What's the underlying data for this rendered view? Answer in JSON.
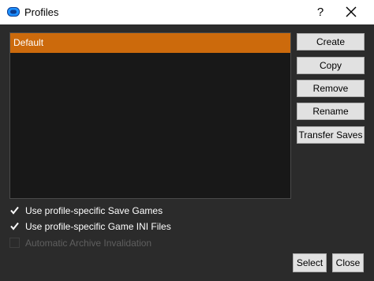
{
  "window": {
    "title": "Profiles",
    "help_label": "?"
  },
  "profiles": [
    "Default"
  ],
  "selected_profile": "Default",
  "buttons": {
    "create": "Create",
    "copy": "Copy",
    "remove": "Remove",
    "rename": "Rename",
    "transfer_saves": "Transfer Saves",
    "select": "Select",
    "close": "Close"
  },
  "options": [
    {
      "label": "Use profile-specific Save Games",
      "checked": true,
      "enabled": true
    },
    {
      "label": "Use profile-specific Game INI Files",
      "checked": true,
      "enabled": true
    },
    {
      "label": "Automatic Archive Invalidation",
      "checked": false,
      "enabled": false
    }
  ],
  "colors": {
    "background": "#2b2b2b",
    "list_background": "#181818",
    "selection": "#cc6a0c",
    "app_icon": "#1e90ff"
  },
  "icons": {
    "app": "mod-organizer-icon",
    "close": "close-icon",
    "check": "checkmark-icon"
  }
}
